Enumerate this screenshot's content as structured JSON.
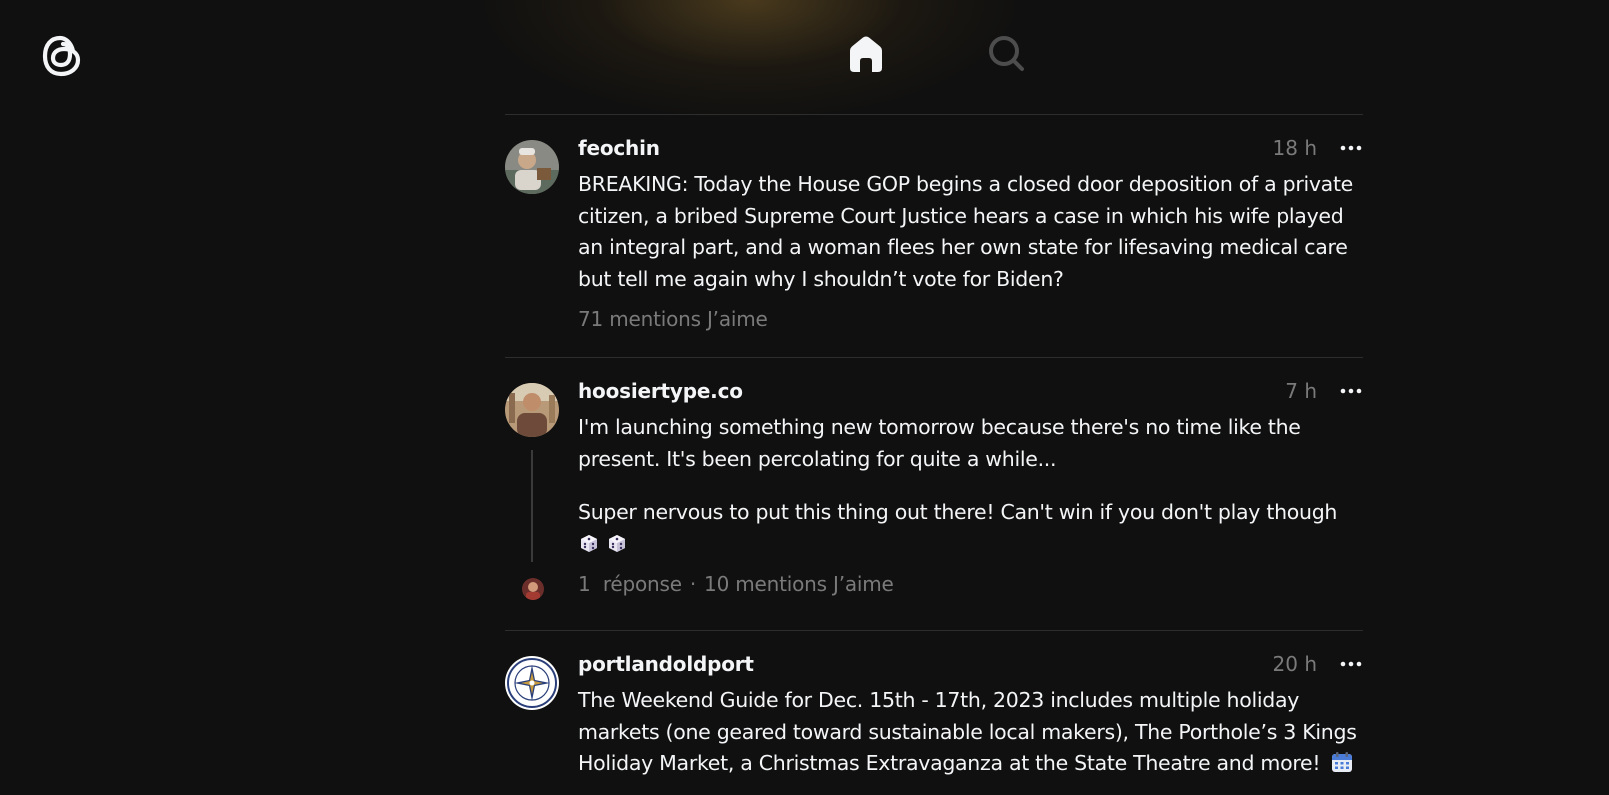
{
  "app": {
    "name": "Threads",
    "accent_text": "#f3f5f7",
    "muted_text": "#7a7a7a",
    "background": "#101010"
  },
  "nav": {
    "logo_icon": "threads-logo-icon",
    "home_icon": "home-icon",
    "search_icon": "search-icon"
  },
  "posts": [
    {
      "username": "feochin",
      "time": "18 h",
      "more_icon": "more-icon",
      "paragraphs": [
        "BREAKING: Today the House GOP begins a closed door deposition of a private citizen, a bribed Supreme Court Justice hears a case in which his wife played an integral part, and a woman flees her own state for lifesaving medical care but tell me again why I shouldn’t vote for Biden?"
      ],
      "likes": "71 mentions J’aime"
    },
    {
      "username": "hoosiertype.co",
      "time": "7 h",
      "more_icon": "more-icon",
      "paragraphs": [
        "I'm launching something new tomorrow because there's no time like the present. It's been percolating for quite a while...",
        "Super nervous to put this thing out there! Can't win if you don't play though"
      ],
      "emojis": [
        "dice-emoji",
        "dice-emoji"
      ],
      "replies": "1  réponse",
      "separator": "·",
      "likes": "10 mentions J’aime"
    },
    {
      "username": "portlandoldport",
      "time": "20 h",
      "more_icon": "more-icon",
      "paragraphs": [
        "The Weekend Guide for Dec. 15th - 17th, 2023 includes multiple holiday markets (one geared toward sustainable local makers), The Porthole’s 3 Kings Holiday Market, a Christmas Extravaganza at the State Theatre and more!"
      ],
      "emojis": [
        "calendar-emoji"
      ]
    }
  ]
}
